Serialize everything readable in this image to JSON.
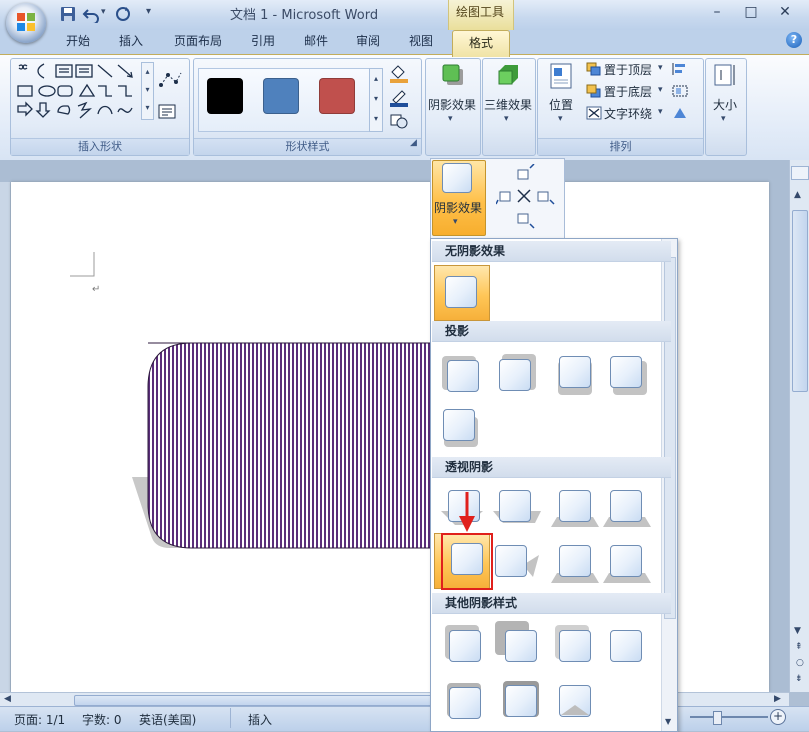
{
  "window": {
    "title": "文档 1 - Microsoft Word",
    "contextual_tab_group": "绘图工具",
    "controls": [
      "–",
      "□",
      "✕"
    ]
  },
  "quick_access": {
    "icons": [
      "save-icon",
      "undo-icon",
      "redo-icon",
      "customize-icon"
    ]
  },
  "tabs": [
    "开始",
    "插入",
    "页面布局",
    "引用",
    "邮件",
    "审阅",
    "视图",
    "格式"
  ],
  "active_tab": "格式",
  "ribbon": {
    "groups": {
      "insert_shapes": "插入形状",
      "shape_styles": "形状样式",
      "arrange": "排列"
    },
    "shape_style_colors": [
      "#000000",
      "#4f81bd",
      "#c0504d"
    ],
    "buttons": {
      "shadow_effects": "阴影效果",
      "3d_effects": "三维效果",
      "position": "位置",
      "bring_to_front": "置于顶层",
      "send_to_back": "置于底层",
      "text_wrapping": "文字环绕",
      "size": "大小"
    }
  },
  "shadow_popup": {
    "button_label": "阴影效果",
    "sections": {
      "none": "无阴影效果",
      "drop": "投影",
      "perspective": "透视阴影",
      "other": "其他阴影样式"
    }
  },
  "document": {
    "shape_fill_color": "#5a2d7a",
    "shadow_color": "#c8c8c8"
  },
  "status": {
    "page": "页面: 1/1",
    "words": "字数: 0",
    "language": "英语(美国)",
    "mode": "插入"
  }
}
